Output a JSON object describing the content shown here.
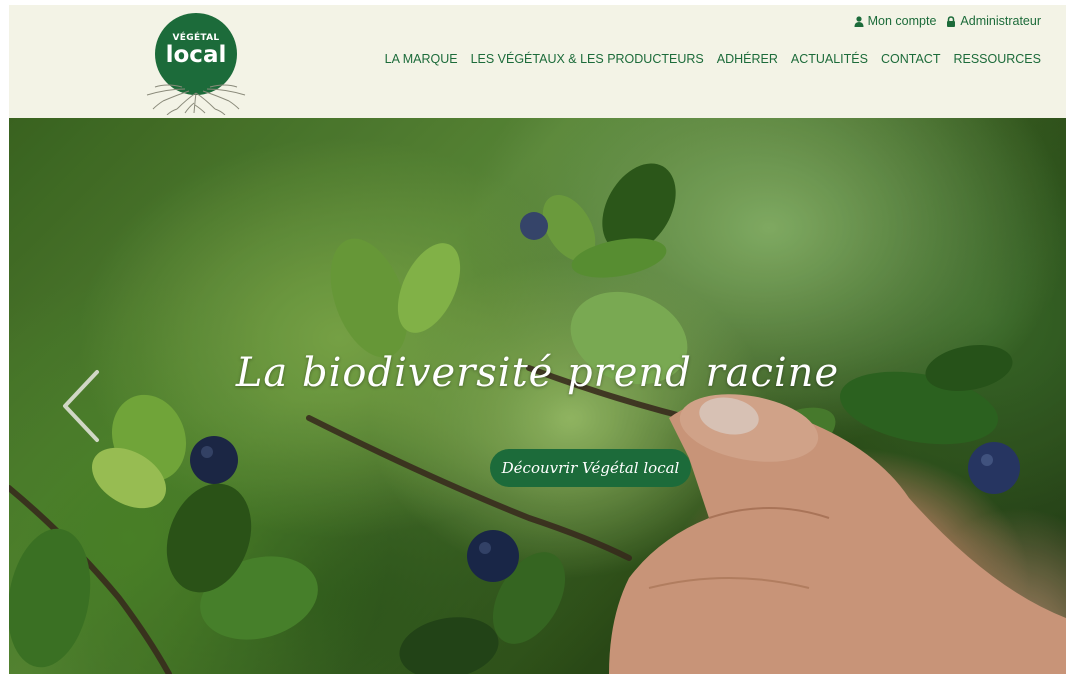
{
  "logo": {
    "top_text": "VÉGÉTAL",
    "main_text": "local"
  },
  "utility": {
    "account_label": "Mon compte",
    "admin_label": "Administrateur"
  },
  "nav": {
    "items": [
      "LA MARQUE",
      "LES VÉGÉTAUX & LES PRODUCTEURS",
      "ADHÉRER",
      "ACTUALITÉS",
      "CONTACT",
      "RESSOURCES"
    ]
  },
  "hero": {
    "title": "La biodiversité prend racine",
    "button_label": "Découvrir Végétal local"
  },
  "colors": {
    "brand_green": "#1c6b3a",
    "header_bg": "#f3f3e6"
  },
  "icons": {
    "account": "user-icon",
    "admin": "lock-icon",
    "prev": "chevron-left-icon"
  }
}
